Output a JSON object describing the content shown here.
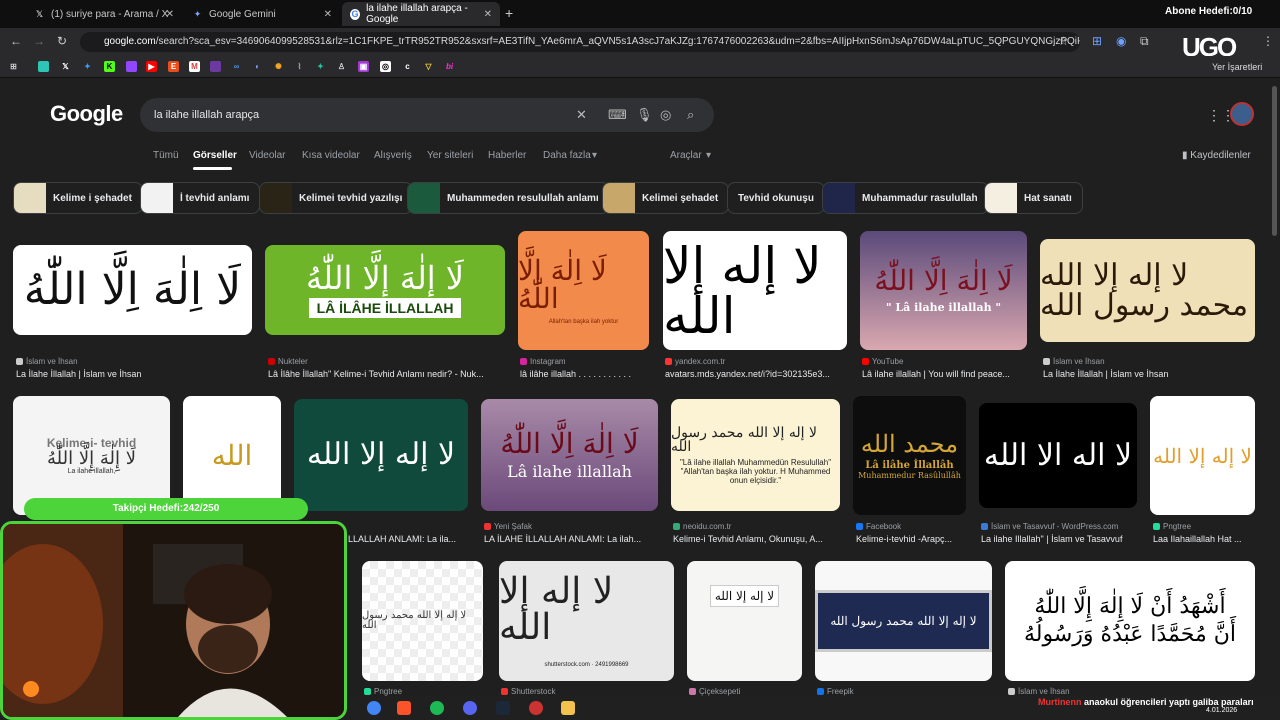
{
  "tabs": [
    {
      "label": "(1) suriye para - Arama / X",
      "icon": "x-icon"
    },
    {
      "label": "Google Gemini",
      "icon": "gemini-icon"
    },
    {
      "label": "la ilahe illallah arapça - Google",
      "icon": "google-icon"
    }
  ],
  "overlay": {
    "abone": "Abone Hedefi:0/10",
    "takipci": "Takipçi Hedefi:242/250",
    "logo": "UGO"
  },
  "url": {
    "host": "google.com",
    "path": "/search?sca_esv=3469064099528531&rlz=1C1FKPE_trTR952TR952&sxsrf=AE3TifN_YAe6mrA_aQVN5s1A3scJ7aKJZg:1767476002263&udm=2&fbs=AIIjpHxnS6mJsAp76DW4aLpTUC_5QPGUYQNGjzPQiP4geIW7z9NrIX..."
  },
  "bookmarks_label": "Yer İşaretleri",
  "search": {
    "query": "la ilahe illallah arapça"
  },
  "nav": [
    "Tümü",
    "Görseller",
    "Videolar",
    "Kısa videolar",
    "Alışveriş",
    "Yer siteleri",
    "Haberler",
    "Daha fazla",
    "Araçlar"
  ],
  "saved": "Kaydedilenler",
  "chips": [
    "Kelime i şehadet",
    "İ tevhid anlamı",
    "Kelimei tevhid yazılışı",
    "Muhammeden resulullah anlamı",
    "Kelimei şehadet",
    "Tevhid okunuşu",
    "Muhammadur rasulullah",
    "Hat sanatı"
  ],
  "row1": [
    {
      "src": "İslam ve İhsan",
      "cap": "La İlahe İllallah | İslam ve İhsan"
    },
    {
      "src": "Nukteler",
      "cap": "Lâ İlâhe İllallah\" Kelime-i Tevhid Anlamı nedir? - Nuk...",
      "text": "LÂ İLÂHE İLLALLAH"
    },
    {
      "src": "Instagram",
      "cap": "lâ ilâhe illallah . . . . . . . . . . .",
      "sub": "Allah'tan başka ilah yoktur"
    },
    {
      "src": "yandex.com.tr",
      "cap": "avatars.mds.yandex.net/i?id=302135e3..."
    },
    {
      "src": "YouTube",
      "cap": "Lâ ilahe illallah | You will find peace...",
      "text": "\" Lâ ilahe illallah \""
    },
    {
      "src": "İslam ve İhsan",
      "cap": "La İlahe İllallah | İslam ve İhsan"
    }
  ],
  "row2": [
    {
      "src": "",
      "cap": "",
      "text": "Kelime-i- tevhid",
      "sub": "La ilahe illallah,"
    },
    {
      "src": "Yeni Şafak",
      "cap": "LA İLAHE İLLALLAH ANLAMI: La ilah...",
      "text": "Lâ ilahe illallah"
    },
    {
      "src": "neoidu.com.tr",
      "cap": "Kelime-i Tevhid Anlamı, Okunuşu, A...",
      "text": "\"Lâ ilahe illallah Muhammedün Resulullah\"",
      "sub": "\"Allah'tan başka ilah yoktur. H Muhammed onun elçisidir.\""
    },
    {
      "src": "Facebook",
      "cap": "Kelime-i-tevhid -Arapç...",
      "text": "Lâ ilâhe İllallâh",
      "sub": "Muhammedur Rasûlullâh"
    },
    {
      "src": "İslam ve Tasavvuf - WordPress.com",
      "cap": "La ilahe Illallah\" | İslam ve Tasavvuf"
    },
    {
      "src": "Pngtree",
      "cap": "Laa Ilahaillallah Hat ..."
    }
  ],
  "row2_partial_cap": "LLALLAH ANLAMI: La ila...",
  "row2_partial_src": "fak",
  "row3": [
    {
      "src": "Pngtree"
    },
    {
      "src": "Shutterstock",
      "wm": "shutterstock.com · 2491998669"
    },
    {
      "src": "Çiçeksepeti"
    },
    {
      "src": "Freepik"
    },
    {
      "src": "İslam ve İhsan"
    }
  ],
  "stream": {
    "user": "Murtinenn",
    "msg": "anaokul öğrencileri yaptı galiba paraları"
  },
  "clock": "4.01.2026"
}
